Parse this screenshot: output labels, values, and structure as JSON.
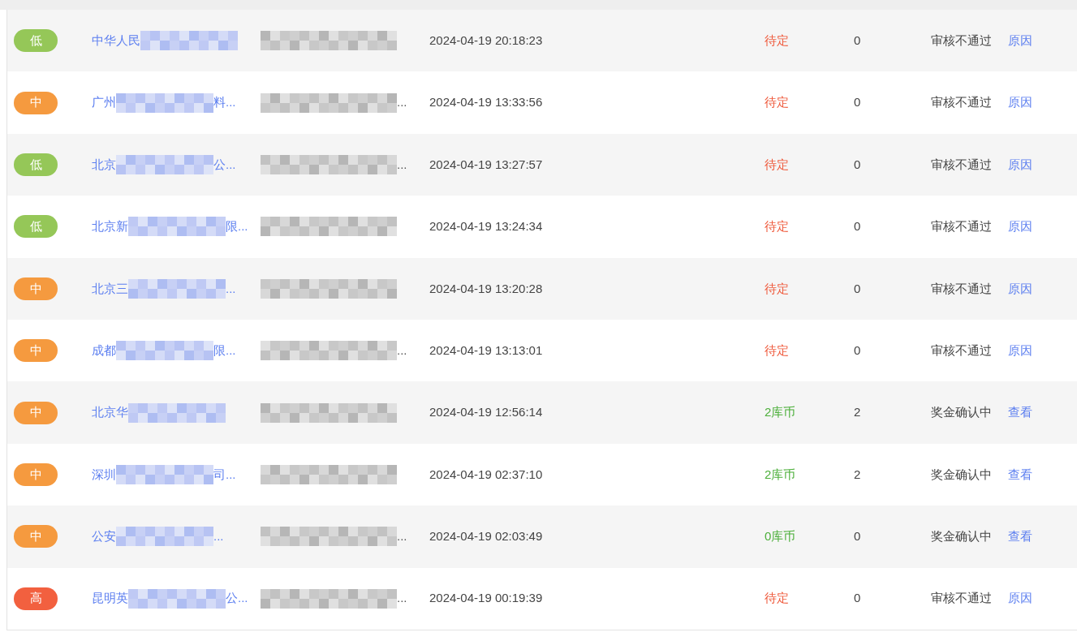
{
  "rows": [
    {
      "priority": {
        "label": "低",
        "color": "#95c758"
      },
      "name_start": "中华人民",
      "detail_end": "",
      "time": "2024-04-19 20:18:23",
      "reward": {
        "kind": "pending",
        "text": "待定"
      },
      "count": "0",
      "status": "审核不通过",
      "action": "原因"
    },
    {
      "priority": {
        "label": "中",
        "color": "#f59a3f"
      },
      "name_start": "广州",
      "name_end": "料...",
      "detail_end": "...",
      "time": "2024-04-19 13:33:56",
      "reward": {
        "kind": "pending",
        "text": "待定"
      },
      "count": "0",
      "status": "审核不通过",
      "action": "原因"
    },
    {
      "priority": {
        "label": "低",
        "color": "#95c758"
      },
      "name_start": "北京",
      "name_end": "公...",
      "detail_end": "...",
      "time": "2024-04-19 13:27:57",
      "reward": {
        "kind": "pending",
        "text": "待定"
      },
      "count": "0",
      "status": "审核不通过",
      "action": "原因"
    },
    {
      "priority": {
        "label": "低",
        "color": "#95c758"
      },
      "name_start": "北京新",
      "name_end": "限...",
      "time": "2024-04-19 13:24:34",
      "reward": {
        "kind": "pending",
        "text": "待定"
      },
      "count": "0",
      "status": "审核不通过",
      "action": "原因"
    },
    {
      "priority": {
        "label": "中",
        "color": "#f59a3f"
      },
      "name_start": "北京三",
      "name_end": "...",
      "time": "2024-04-19 13:20:28",
      "reward": {
        "kind": "pending",
        "text": "待定"
      },
      "count": "0",
      "status": "审核不通过",
      "action": "原因"
    },
    {
      "priority": {
        "label": "中",
        "color": "#f59a3f"
      },
      "name_start": "成都",
      "name_end": "限...",
      "detail_end": "...",
      "time": "2024-04-19 13:13:01",
      "reward": {
        "kind": "pending",
        "text": "待定"
      },
      "count": "0",
      "status": "审核不通过",
      "action": "原因"
    },
    {
      "priority": {
        "label": "中",
        "color": "#f59a3f"
      },
      "name_start": "北京华",
      "time": "2024-04-19 12:56:14",
      "reward": {
        "kind": "coins",
        "text": "2库币"
      },
      "count": "2",
      "status": "奖金确认中",
      "action": "查看"
    },
    {
      "priority": {
        "label": "中",
        "color": "#f59a3f"
      },
      "name_start": "深圳",
      "name_end": "司...",
      "time": "2024-04-19 02:37:10",
      "reward": {
        "kind": "coins",
        "text": "2库币"
      },
      "count": "2",
      "status": "奖金确认中",
      "action": "查看"
    },
    {
      "priority": {
        "label": "中",
        "color": "#f59a3f"
      },
      "name_start": "公安",
      "name_end": "...",
      "detail_end": "...",
      "time": "2024-04-19 02:03:49",
      "reward": {
        "kind": "coins",
        "text": "0库币"
      },
      "count": "0",
      "status": "奖金确认中",
      "action": "查看"
    },
    {
      "priority": {
        "label": "高",
        "color": "#f2603f"
      },
      "name_start": "昆明英",
      "name_end": "公...",
      "detail_end": "...",
      "time": "2024-04-19 00:19:39",
      "reward": {
        "kind": "pending",
        "text": "待定"
      },
      "count": "0",
      "status": "审核不通过",
      "action": "原因"
    }
  ]
}
